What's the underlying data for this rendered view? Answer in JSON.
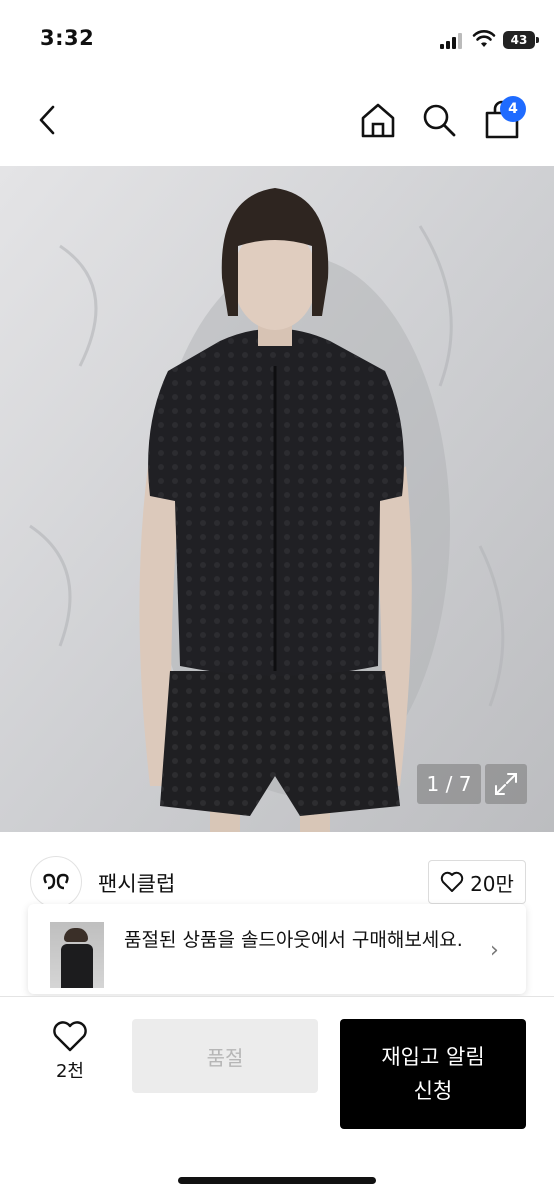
{
  "status_bar": {
    "time": "3:32",
    "battery": "43",
    "icons": [
      "signal-icon",
      "wifi-icon",
      "battery-icon"
    ]
  },
  "nav": {
    "icons": [
      "back-chevron-icon",
      "home-icon",
      "search-icon",
      "shopping-bag-icon"
    ],
    "cart_count": "4",
    "badge_color": "#1f6bff"
  },
  "gallery": {
    "page_indicator": "1 / 7",
    "icons": [
      "chevron-right-icon",
      "expand-icon"
    ]
  },
  "brand": {
    "name": "팬시클럽",
    "like_count": "20만",
    "icons": [
      "brand-logo-icon",
      "heart-outline-icon"
    ]
  },
  "soldout_banner": {
    "text": "품절된 상품을 솔드아웃에서 구매해보세요.",
    "icons": [
      "chevron-right-icon"
    ]
  },
  "bottom_bar": {
    "wish_count": "2천",
    "soldout_label": "품절",
    "restock_label": "재입고 알림 신청",
    "icons": [
      "heart-outline-icon"
    ],
    "colors": {
      "soldout_bg": "#ececec",
      "restock_bg": "#000000"
    }
  }
}
